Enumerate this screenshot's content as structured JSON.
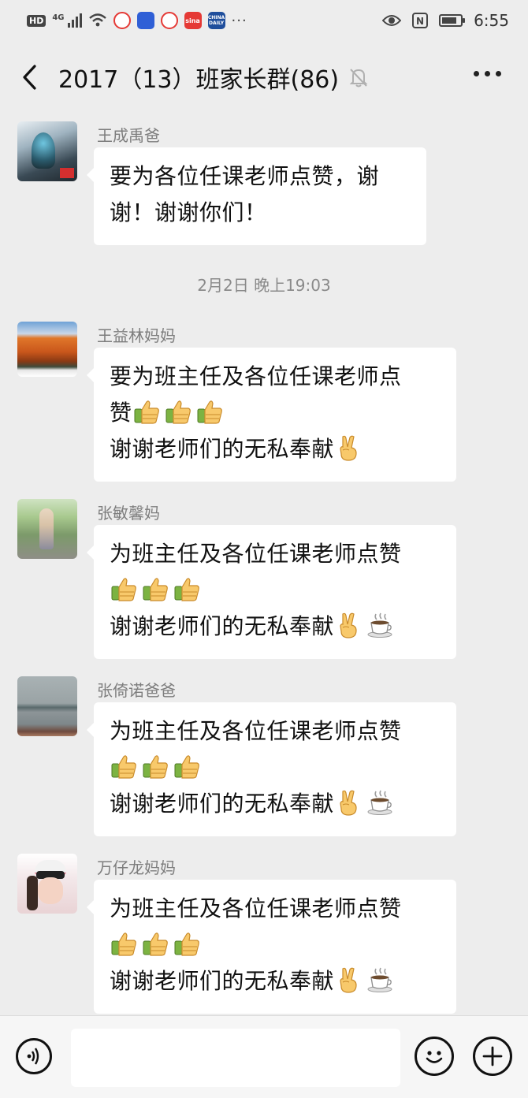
{
  "status_bar": {
    "hd": "HD",
    "network": "4G",
    "time": "6:55",
    "icons": [
      "signal-icon",
      "wifi-icon",
      "app-icon",
      "baidu-icon",
      "app-icon",
      "weibo-icon",
      "china-daily-icon",
      "more-dots",
      "eye-icon",
      "nfc-icon",
      "battery-icon"
    ],
    "weibo_label": "sina",
    "china_daily_label": "CHINA DAILY",
    "more": "···"
  },
  "header": {
    "title": "2017（13）班家长群(86)",
    "icons": [
      "back-icon",
      "mute-bell-icon",
      "more-icon"
    ]
  },
  "messages": [
    {
      "sender": "王成禹爸",
      "lines": [
        "要为各位任课老师点赞，谢",
        "谢！谢谢你们！"
      ]
    },
    {
      "sender": "王益林妈妈",
      "lines": [
        "要为班主任及各位任课老师点",
        "赞",
        "谢谢老师们的无私奉献"
      ],
      "emoji": [
        "thumbs-up-icon",
        "victory-hand-icon"
      ]
    },
    {
      "sender": "张敏馨妈",
      "lines": [
        "为班主任及各位任课老师点赞",
        "",
        "谢谢老师们的无私奉献"
      ],
      "emoji": [
        "thumbs-up-icon",
        "victory-hand-icon",
        "coffee-icon"
      ]
    },
    {
      "sender": "张倚诺爸爸",
      "lines": [
        "为班主任及各位任课老师点赞",
        "",
        "谢谢老师们的无私奉献"
      ],
      "emoji": [
        "thumbs-up-icon",
        "victory-hand-icon",
        "coffee-icon"
      ]
    },
    {
      "sender": "万仔龙妈妈",
      "lines": [
        "为班主任及各位任课老师点赞",
        "",
        "谢谢老师们的无私奉献"
      ],
      "emoji": [
        "thumbs-up-icon",
        "victory-hand-icon",
        "coffee-icon"
      ]
    }
  ],
  "time_separator": "2月2日 晚上19:03",
  "input_bar": {
    "icons": [
      "voice-icon",
      "emoji-icon",
      "plus-icon"
    ],
    "placeholder": ""
  },
  "colors": {
    "background": "#ededed",
    "bubble": "#ffffff",
    "sender_text": "#7d7d7d"
  }
}
